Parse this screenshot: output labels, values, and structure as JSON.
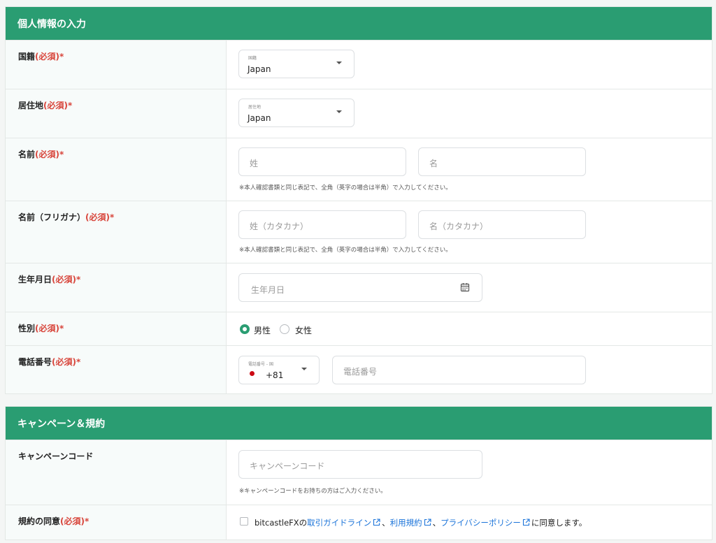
{
  "section_personal": {
    "title": "個人情報の入力",
    "nationality": {
      "label": "国籍",
      "required": "(必須)*",
      "select_label": "国籍",
      "value": "Japan"
    },
    "residence": {
      "label": "居住地",
      "required": "(必須)*",
      "select_label": "居住地",
      "value": "Japan"
    },
    "name": {
      "label": "名前",
      "required": "(必須)*",
      "last_placeholder": "姓",
      "first_placeholder": "名",
      "note": "※本人確認書類と同じ表記で、全角（英字の場合は半角）で入力してください。"
    },
    "name_kana": {
      "label": "名前（フリガナ）",
      "required": "(必須)*",
      "last_placeholder": "姓（カタカナ）",
      "first_placeholder": "名（カタカナ）",
      "note": "※本人確認書類と同じ表記で、全角（英字の場合は半角）で入力してください。"
    },
    "birthdate": {
      "label": "生年月日",
      "required": "(必須)*",
      "placeholder": "生年月日",
      "icon": "calendar-icon"
    },
    "gender": {
      "label": "性別",
      "required": "(必須)*",
      "options": [
        "男性",
        "女性"
      ],
      "selected": "男性"
    },
    "phone": {
      "label": "電話番号",
      "required": "(必須)*",
      "country_label": "電話番号 - 国",
      "country_code": "+81",
      "placeholder": "電話番号"
    }
  },
  "section_campaign": {
    "title": "キャンペーン＆規約",
    "campaign": {
      "label": "キャンペーンコード",
      "placeholder": "キャンペーンコード",
      "note": "※キャンペーンコードをお持ちの方はご入力ください。"
    },
    "agreement": {
      "label": "規約の同意",
      "required": "(必須)*",
      "prefix": "bitcastleFXの",
      "link1": "取引ガイドライン",
      "sep1": "、",
      "link2": "利用規約",
      "sep2": "、",
      "link3": "プライバシーポリシー",
      "suffix": "に同意します。"
    }
  },
  "colors": {
    "brand_green": "#2a9d72",
    "required_red": "#d8453b",
    "link_blue": "#1a73d9"
  }
}
